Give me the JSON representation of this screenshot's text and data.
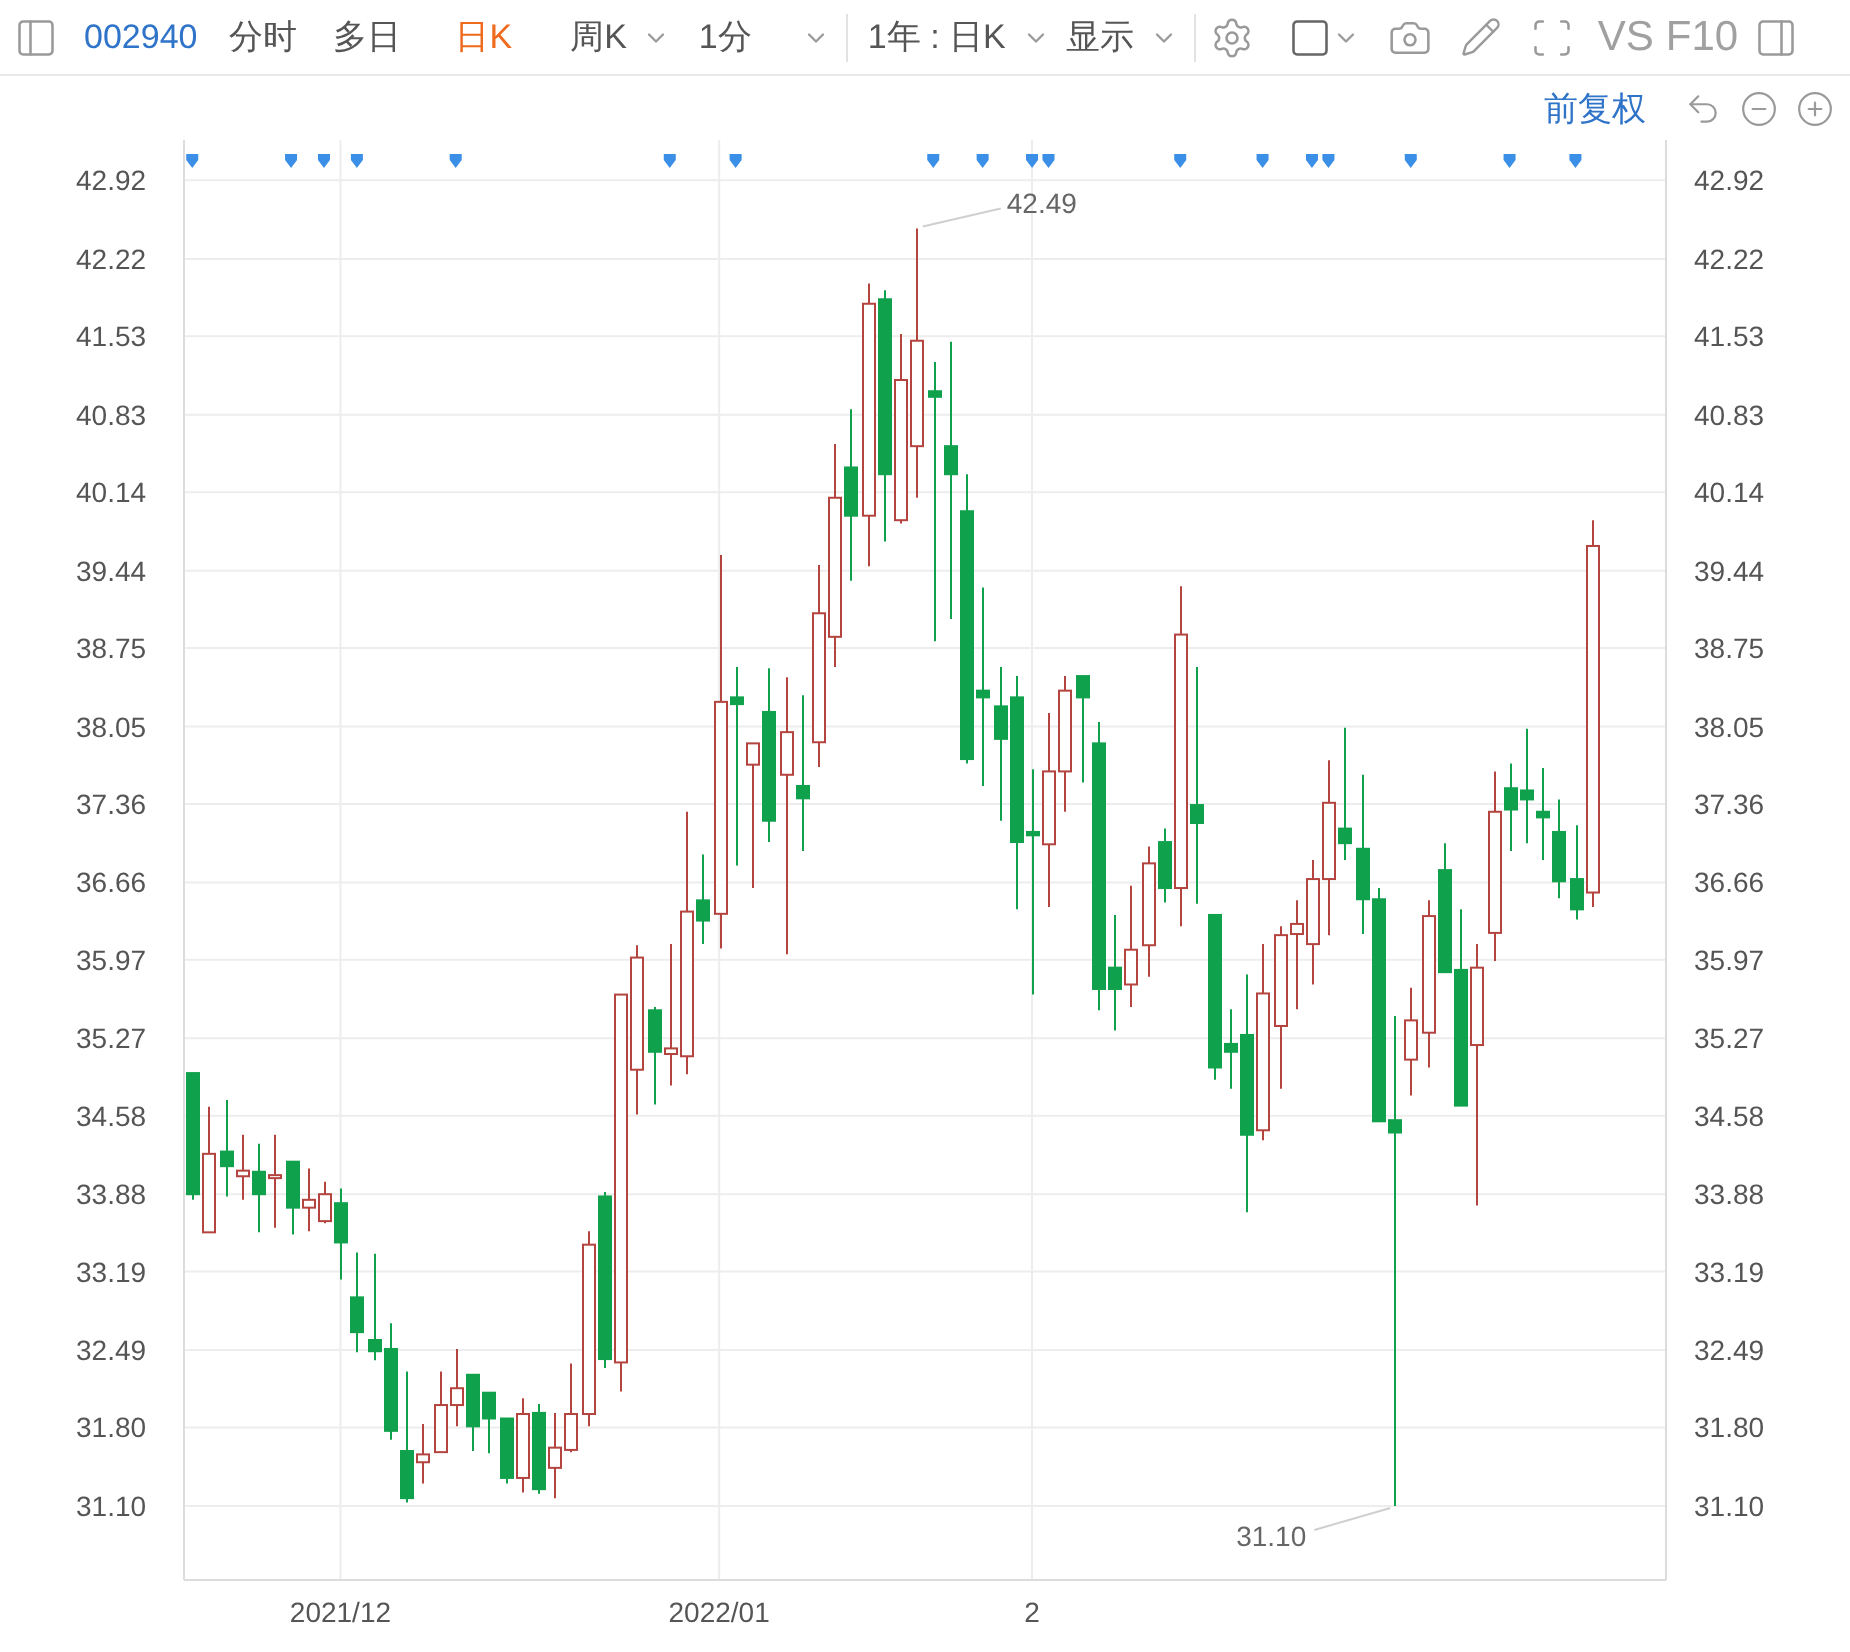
{
  "toolbar": {
    "code": "002940",
    "tabs": [
      {
        "label": "分时",
        "selected": false
      },
      {
        "label": "多日",
        "selected": false
      },
      {
        "label": "日K",
        "selected": true
      }
    ],
    "dropdowns": [
      {
        "label": "周K"
      },
      {
        "label": "1分"
      },
      {
        "label": "1年 : 日K"
      },
      {
        "label": "显示"
      }
    ],
    "text_tools": [
      "VS",
      "F10"
    ]
  },
  "adjust_link": "前复权",
  "candle_events": [
    true,
    false,
    false,
    false,
    false,
    false,
    true,
    false,
    true,
    false,
    true,
    false,
    false,
    false,
    false,
    false,
    true,
    false,
    false,
    false,
    false,
    false,
    false,
    false,
    false,
    false,
    false,
    false,
    false,
    true,
    false,
    false,
    false,
    true,
    false,
    false,
    false,
    false,
    false,
    false,
    false,
    false,
    false,
    false,
    false,
    true,
    false,
    false,
    true,
    false,
    false,
    true,
    true,
    false,
    false,
    false,
    false,
    false,
    false,
    false,
    true,
    false,
    false,
    false,
    false,
    true,
    false,
    false,
    true,
    true,
    false,
    false,
    false,
    false,
    true,
    false,
    false,
    false,
    false,
    false,
    true,
    false,
    false,
    false,
    true,
    false
  ],
  "chart_data": {
    "type": "candlestick",
    "grid": true,
    "categories": [
      null,
      null,
      null,
      null,
      null,
      null,
      null,
      null,
      null,
      "2021/12",
      null,
      null,
      null,
      null,
      null,
      null,
      null,
      null,
      null,
      null,
      null,
      null,
      null,
      null,
      null,
      null,
      null,
      null,
      null,
      null,
      null,
      null,
      "2022/01",
      null,
      null,
      null,
      null,
      null,
      null,
      null,
      null,
      null,
      null,
      null,
      null,
      null,
      null,
      null,
      null,
      null,
      null,
      "2",
      null,
      null,
      null,
      null,
      null,
      null,
      null,
      null,
      null,
      null,
      null,
      null,
      null,
      null,
      null,
      null,
      null,
      null,
      null,
      null,
      null,
      null,
      null,
      null,
      null,
      null,
      null,
      null,
      null,
      null,
      null,
      null,
      null,
      null
    ],
    "ylim": [
      30.44,
      43.28
    ],
    "yticks": [
      {
        "value": 42.92,
        "label": "42.92"
      },
      {
        "value": 42.22,
        "label": "42.22"
      },
      {
        "value": 41.53,
        "label": "41.53"
      },
      {
        "value": 40.83,
        "label": "40.83"
      },
      {
        "value": 40.14,
        "label": "40.14"
      },
      {
        "value": 39.44,
        "label": "39.44"
      },
      {
        "value": 38.75,
        "label": "38.75"
      },
      {
        "value": 38.05,
        "label": "38.05"
      },
      {
        "value": 37.36,
        "label": "37.36"
      },
      {
        "value": 36.66,
        "label": "36.66"
      },
      {
        "value": 35.97,
        "label": "35.97"
      },
      {
        "value": 35.27,
        "label": "35.27"
      },
      {
        "value": 34.58,
        "label": "34.58"
      },
      {
        "value": 33.88,
        "label": "33.88"
      },
      {
        "value": 33.19,
        "label": "33.19"
      },
      {
        "value": 32.49,
        "label": "32.49"
      },
      {
        "value": 31.8,
        "label": "31.80"
      },
      {
        "value": 31.1,
        "label": "31.10"
      }
    ],
    "ohlc": [
      [
        34.96,
        34.96,
        33.83,
        33.88
      ],
      [
        33.54,
        34.66,
        33.54,
        34.24
      ],
      [
        34.26,
        34.72,
        33.86,
        34.13
      ],
      [
        34.04,
        34.41,
        33.83,
        34.09
      ],
      [
        34.08,
        34.33,
        33.54,
        33.88
      ],
      [
        34.03,
        34.41,
        33.58,
        34.05
      ],
      [
        34.17,
        34.17,
        33.52,
        33.76
      ],
      [
        33.76,
        34.11,
        33.55,
        33.83
      ],
      [
        33.64,
        33.99,
        33.62,
        33.88
      ],
      [
        33.8,
        33.93,
        33.12,
        33.45
      ],
      [
        32.96,
        33.36,
        32.47,
        32.65
      ],
      [
        32.58,
        33.35,
        32.4,
        32.48
      ],
      [
        32.5,
        32.73,
        31.69,
        31.77
      ],
      [
        31.59,
        32.3,
        31.13,
        31.17
      ],
      [
        31.49,
        31.83,
        31.3,
        31.56
      ],
      [
        31.58,
        32.3,
        31.58,
        32.0
      ],
      [
        32.0,
        32.5,
        31.81,
        32.15
      ],
      [
        32.27,
        32.27,
        31.59,
        31.81
      ],
      [
        32.11,
        32.11,
        31.57,
        31.88
      ],
      [
        31.88,
        31.88,
        31.3,
        31.35
      ],
      [
        31.35,
        32.06,
        31.22,
        31.92
      ],
      [
        31.93,
        32.01,
        31.21,
        31.25
      ],
      [
        31.44,
        31.93,
        31.17,
        31.62
      ],
      [
        31.6,
        32.37,
        31.58,
        31.92
      ],
      [
        31.92,
        33.55,
        31.81,
        33.43
      ],
      [
        33.86,
        33.9,
        32.33,
        32.41
      ],
      [
        32.38,
        35.66,
        32.12,
        35.66
      ],
      [
        34.99,
        36.1,
        34.59,
        35.99
      ],
      [
        35.52,
        35.55,
        34.68,
        35.15
      ],
      [
        35.13,
        36.11,
        34.85,
        35.18
      ],
      [
        35.11,
        37.29,
        34.95,
        36.4
      ],
      [
        36.5,
        36.91,
        36.11,
        36.32
      ],
      [
        36.38,
        39.58,
        36.07,
        38.27
      ],
      [
        38.31,
        38.58,
        36.81,
        38.25
      ],
      [
        37.71,
        37.9,
        36.61,
        37.9
      ],
      [
        38.18,
        38.57,
        37.02,
        37.21
      ],
      [
        37.62,
        38.49,
        36.02,
        38.0
      ],
      [
        37.52,
        38.33,
        36.94,
        37.41
      ],
      [
        37.91,
        39.49,
        37.69,
        39.06
      ],
      [
        38.85,
        40.57,
        38.58,
        40.09
      ],
      [
        40.36,
        40.88,
        39.35,
        39.93
      ],
      [
        39.93,
        42.0,
        39.48,
        41.82
      ],
      [
        41.86,
        41.94,
        39.7,
        40.3
      ],
      [
        39.89,
        41.55,
        39.86,
        41.14
      ],
      [
        40.55,
        42.49,
        40.09,
        41.49
      ],
      [
        41.04,
        41.3,
        38.81,
        40.99
      ],
      [
        40.55,
        41.48,
        39.01,
        40.3
      ],
      [
        39.97,
        40.3,
        37.72,
        37.76
      ],
      [
        38.37,
        39.29,
        37.52,
        38.31
      ],
      [
        38.23,
        38.58,
        37.21,
        37.94
      ],
      [
        38.31,
        38.5,
        36.42,
        37.02
      ],
      [
        37.11,
        37.67,
        35.66,
        37.08
      ],
      [
        37.0,
        38.17,
        36.44,
        37.65
      ],
      [
        37.65,
        38.5,
        37.29,
        38.37
      ],
      [
        38.5,
        38.5,
        37.55,
        38.31
      ],
      [
        37.9,
        38.09,
        35.52,
        35.71
      ],
      [
        35.9,
        36.37,
        35.34,
        35.71
      ],
      [
        35.75,
        36.63,
        35.55,
        36.06
      ],
      [
        36.1,
        36.98,
        35.82,
        36.83
      ],
      [
        37.02,
        37.14,
        36.48,
        36.61
      ],
      [
        36.61,
        39.3,
        36.27,
        38.87
      ],
      [
        37.35,
        38.58,
        36.47,
        37.19
      ],
      [
        36.37,
        36.37,
        34.9,
        35.01
      ],
      [
        35.22,
        35.53,
        34.82,
        35.15
      ],
      [
        35.3,
        35.84,
        33.72,
        34.41
      ],
      [
        34.45,
        36.11,
        34.36,
        35.67
      ],
      [
        35.38,
        36.27,
        34.82,
        36.19
      ],
      [
        36.2,
        36.5,
        35.53,
        36.29
      ],
      [
        36.11,
        36.86,
        35.75,
        36.69
      ],
      [
        36.69,
        37.75,
        36.19,
        37.37
      ],
      [
        37.14,
        38.04,
        36.86,
        37.01
      ],
      [
        36.96,
        37.62,
        36.2,
        36.51
      ],
      [
        36.51,
        36.61,
        34.53,
        34.53
      ],
      [
        34.54,
        35.47,
        31.1,
        34.43
      ],
      [
        35.08,
        35.72,
        34.76,
        35.43
      ],
      [
        35.32,
        36.5,
        35.01,
        36.36
      ],
      [
        36.77,
        37.01,
        35.86,
        35.86
      ],
      [
        35.88,
        36.42,
        34.67,
        34.67
      ],
      [
        35.21,
        36.11,
        33.78,
        35.9
      ],
      [
        36.21,
        37.65,
        35.96,
        37.29
      ],
      [
        37.5,
        37.72,
        36.94,
        37.31
      ],
      [
        37.48,
        38.03,
        37.01,
        37.4
      ],
      [
        37.29,
        37.68,
        36.86,
        37.24
      ],
      [
        37.11,
        37.4,
        36.52,
        36.67
      ],
      [
        36.69,
        37.17,
        36.33,
        36.42
      ],
      [
        36.57,
        39.89,
        36.44,
        39.66
      ]
    ],
    "annotations": [
      "42.49",
      "31.10"
    ]
  },
  "right_axis_labels": [
    "42.92",
    "42.22",
    "41.53",
    "40.83",
    "40.14",
    "39.44",
    "38.75",
    "38.05",
    "37.36",
    "36.66",
    "35.97",
    "35.27",
    "34.58",
    "33.88",
    "33.19",
    "32.49",
    "31.80",
    "31.10"
  ]
}
